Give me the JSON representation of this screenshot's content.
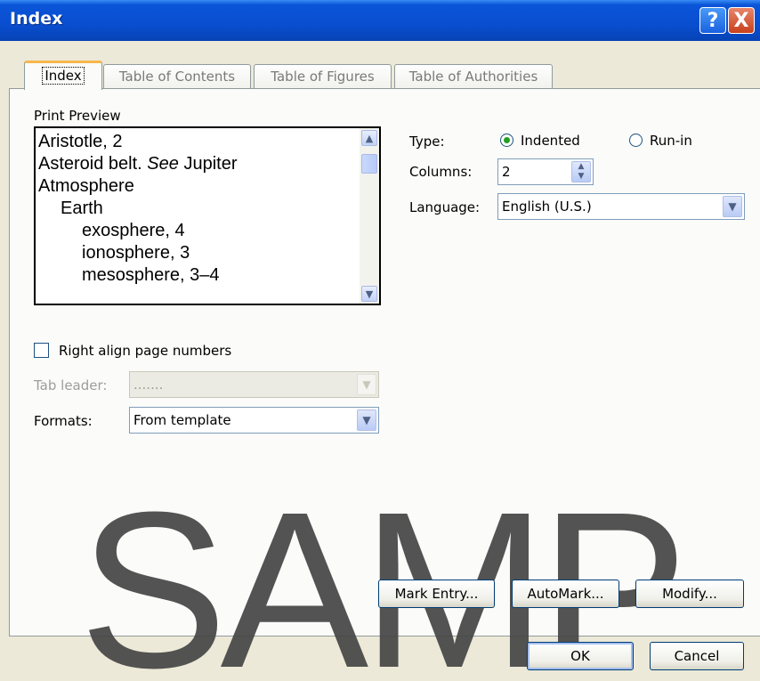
{
  "window": {
    "title": "Index",
    "help_glyph": "?",
    "close_glyph": "X"
  },
  "tabs": [
    {
      "label": "Index",
      "active": true
    },
    {
      "label": "Table of Contents",
      "active": false
    },
    {
      "label": "Table of Figures",
      "active": false
    },
    {
      "label": "Table of Authorities",
      "active": false
    }
  ],
  "print_preview": {
    "label": "Print Preview",
    "entries": [
      {
        "text": "Aristotle, 2"
      },
      {
        "pre": "Asteroid belt. ",
        "italic": "See",
        "post": " Jupiter"
      },
      {
        "text": "Atmosphere"
      },
      {
        "text": "Earth"
      },
      {
        "text": "exosphere, 4"
      },
      {
        "text": "ionosphere, 3"
      },
      {
        "text": "mesosphere, 3–4"
      }
    ]
  },
  "options": {
    "type_label": "Type:",
    "indented_label": "Indented",
    "runin_label": "Run-in",
    "selected_type": "Indented",
    "columns_label": "Columns:",
    "columns_value": "2",
    "language_label": "Language:",
    "language_value": "English (U.S.)"
  },
  "right_align_label": "Right align page numbers",
  "right_align_checked": false,
  "tab_leader": {
    "label": "Tab leader:",
    "value": "......."
  },
  "formats": {
    "label": "Formats:",
    "value": "From template"
  },
  "buttons": {
    "mark_entry": "Mark Entry...",
    "automark": "AutoMark...",
    "modify": "Modify...",
    "ok": "OK",
    "cancel": "Cancel"
  },
  "watermark": "SAMP"
}
